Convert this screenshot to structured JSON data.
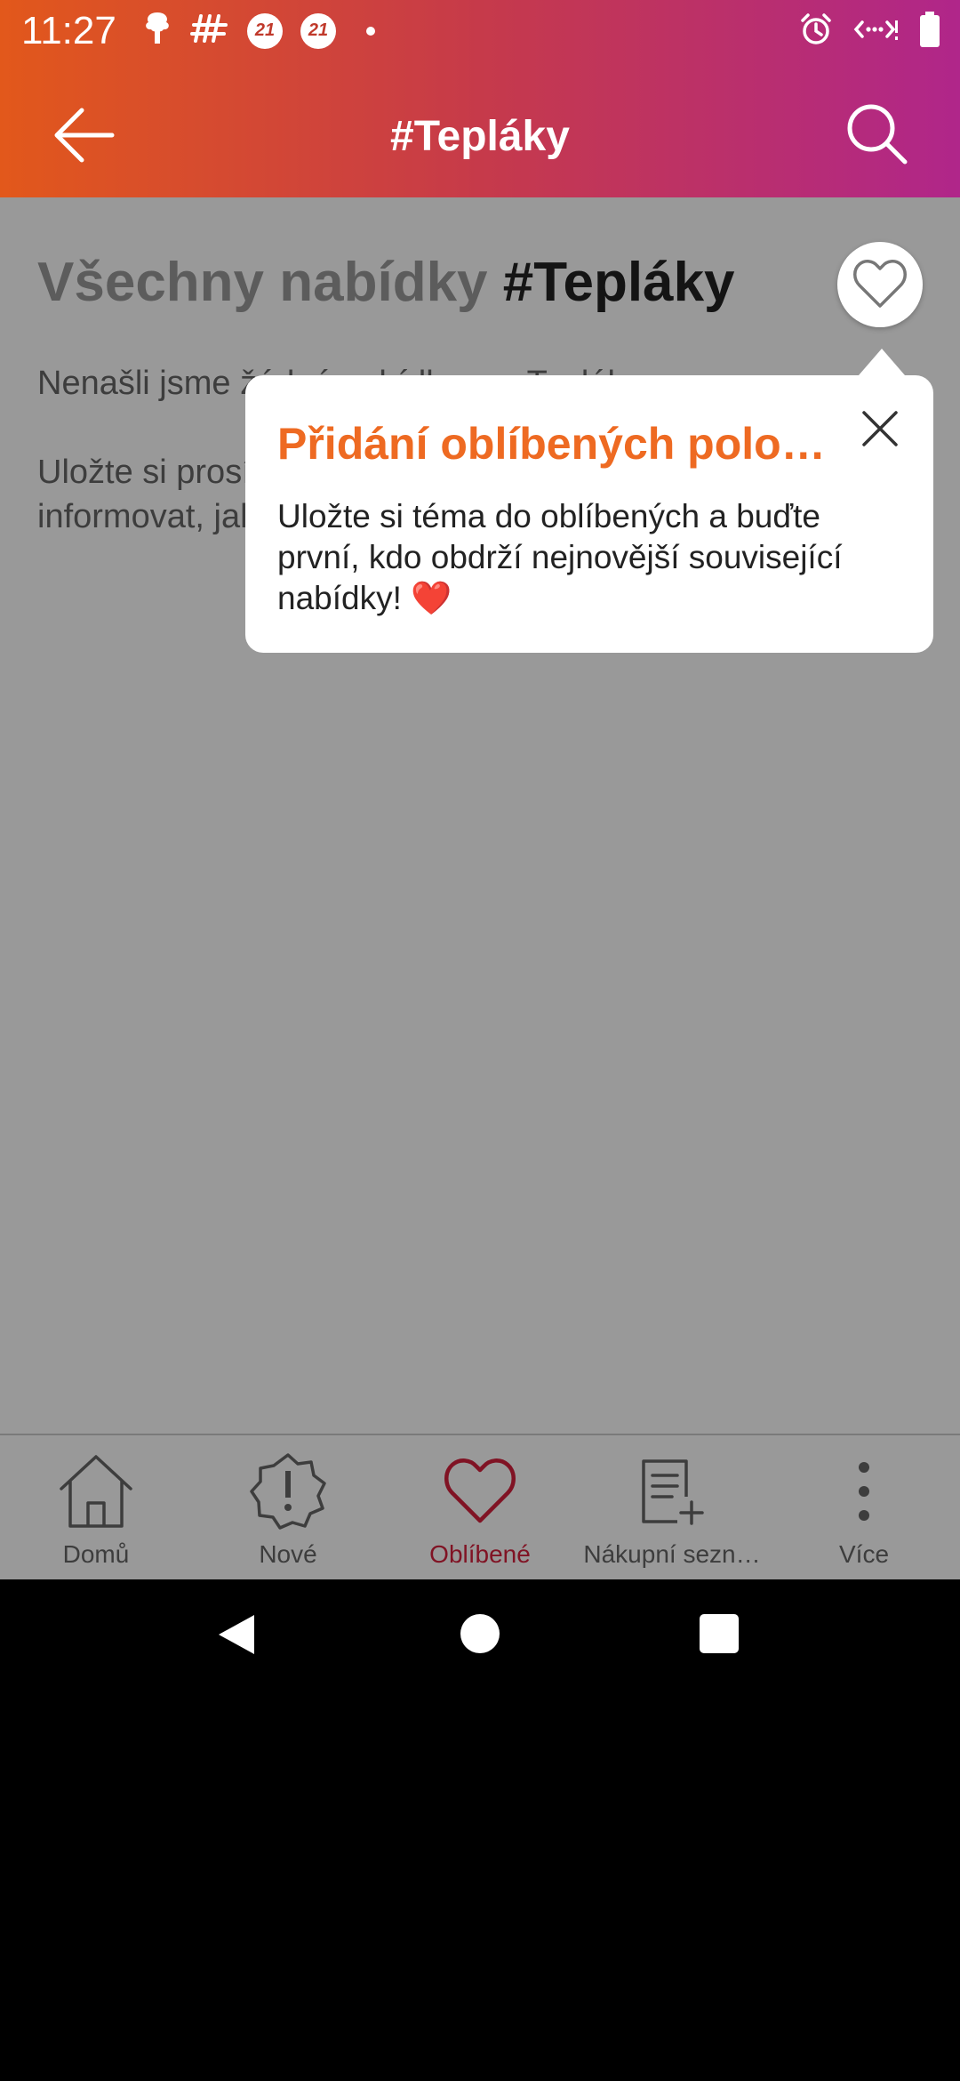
{
  "status_bar": {
    "time": "11:27",
    "notif_icons": [
      "tree-icon",
      "hashtag-icon",
      "badge-21-icon",
      "badge-21-icon",
      "dot-icon"
    ],
    "badge_text": "21",
    "right_icons": [
      "alarm-icon",
      "data-transfer-icon",
      "battery-icon"
    ]
  },
  "appbar": {
    "title": "#Tepláky",
    "gradient": [
      "#e2581b",
      "#b0268a"
    ]
  },
  "content": {
    "heading_prefix": "Všechny nabídky ",
    "heading_tag": "#Tepláky",
    "message1": "Nenašli jsme žádné nabídky pro Tepláky",
    "message2": "Uložte si prosím téma do oblíbených a my vás budeme informovat, jakmile budou nabídky k dispozici."
  },
  "tooltip": {
    "title": "Přidání oblíbených položek",
    "text": "Uložte si téma do oblíbených a buďte první, kdo obdrží nejnovější související nabídky! ❤️",
    "title_color": "#ee6a22"
  },
  "bottom_nav": {
    "items": [
      {
        "label": "Domů",
        "icon": "home-icon"
      },
      {
        "label": "Nové",
        "icon": "new-badge-icon"
      },
      {
        "label": "Oblíbené",
        "icon": "heart-icon",
        "active": true
      },
      {
        "label": "Nákupní sezn…",
        "icon": "shopping-list-icon"
      },
      {
        "label": "Více",
        "icon": "more-vertical-icon"
      }
    ],
    "active_color": "#d6203d"
  }
}
